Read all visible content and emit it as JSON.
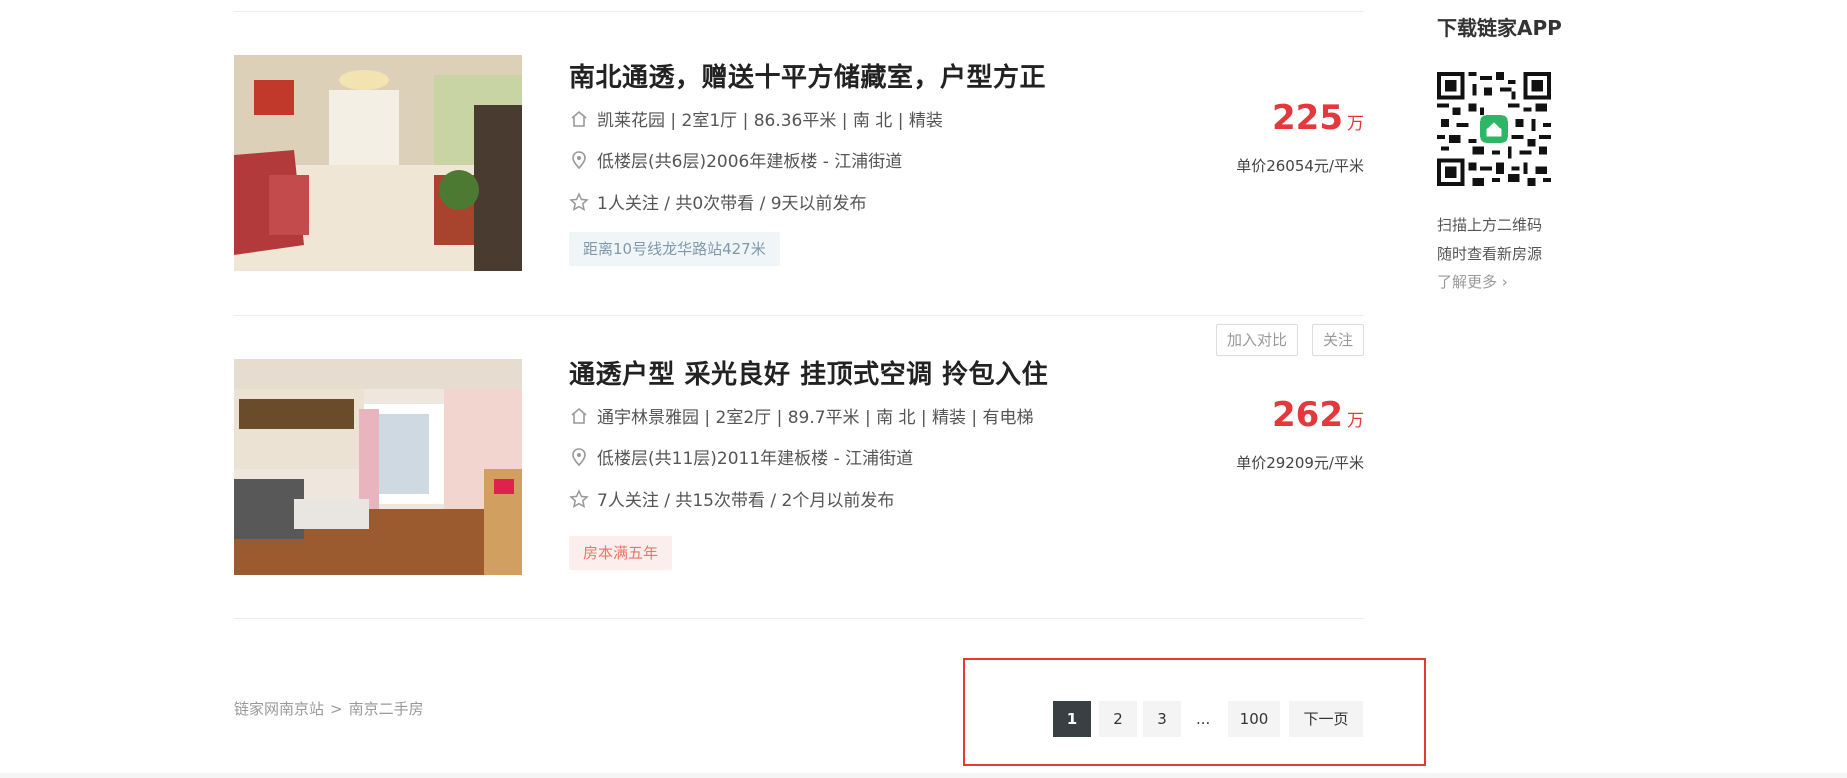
{
  "listings": [
    {
      "title": "南北通透，赠送十平方储藏室，户型方正",
      "house_info": "凯莱花园 | 2室1厅 | 86.36平米 | 南 北 | 精装",
      "position_info": "低楼层(共6层)2006年建板楼 - 江浦街道",
      "follow_info": "1人关注 / 共0次带看 / 9天以前发布",
      "tag": "距离10号线龙华路站427米",
      "total_price": "225",
      "price_unit": "万",
      "unit_price": "单价26054元/平米"
    },
    {
      "title": "通透户型 采光良好 挂顶式空调 拎包入住",
      "house_info": "通宇林景雅园 | 2室2厅 | 89.7平米 | 南 北 | 精装 | 有电梯",
      "position_info": "低楼层(共11层)2011年建板楼 - 江浦街道",
      "follow_info": "7人关注 / 共15次带看 / 2个月以前发布",
      "tag": "房本满五年",
      "total_price": "262",
      "price_unit": "万",
      "unit_price": "单价29209元/平米",
      "compare_label": "加入对比",
      "follow_label": "关注"
    }
  ],
  "breadcrumb": {
    "site": "链家网南京站",
    "separator": ">",
    "section": "南京二手房"
  },
  "pagination": {
    "pages": [
      "1",
      "2",
      "3"
    ],
    "ellipsis": "...",
    "last": "100",
    "next": "下一页",
    "current": "1"
  },
  "sidebar": {
    "title": "下载链家APP",
    "line1": "扫描上方二维码",
    "line2": "随时查看新房源",
    "learn_more": "了解更多 ›"
  },
  "colors": {
    "price": "#e4393c",
    "active_page": "#394043",
    "highlight_box": "#e53935",
    "qr_accent": "#2fb566"
  },
  "icons": [
    "house-icon",
    "location-pin-icon",
    "star-icon",
    "qr-code-icon"
  ]
}
